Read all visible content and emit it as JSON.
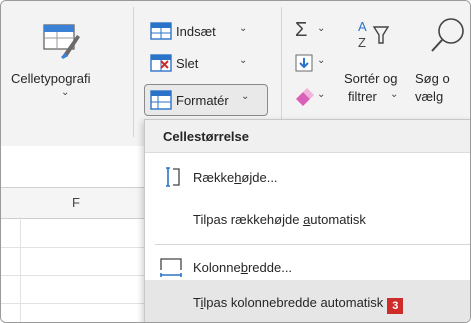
{
  "ribbon": {
    "cell_styles_label": "Celletypografi",
    "insert_label": "Indsæt",
    "delete_label": "Slet",
    "format_label": "Formatér",
    "sort_filter_label_1": "Sortér og",
    "sort_filter_label_2": "filtrer",
    "find_select_label_1": "Søg o",
    "find_select_label_2": "vælg",
    "chevron": "⌄"
  },
  "sheet": {
    "column_header": "F"
  },
  "format_menu": {
    "section_title": "Cellestørrelse",
    "items": [
      {
        "pre": "Række",
        "ul": "h",
        "post": "øjde..."
      },
      {
        "pre": "Tilpas rækkehøjde ",
        "ul": "a",
        "post": "utomatisk"
      },
      {
        "pre": "Kolonne",
        "ul": "b",
        "post": "redde..."
      },
      {
        "pre": "T",
        "ul": "i",
        "post": "lpas kolonnebredde automatisk",
        "badge": "3"
      }
    ]
  },
  "colors": {
    "accent_blue": "#2b73c9",
    "badge_red": "#d02b2b",
    "hover_gray": "#e6e6e6"
  }
}
